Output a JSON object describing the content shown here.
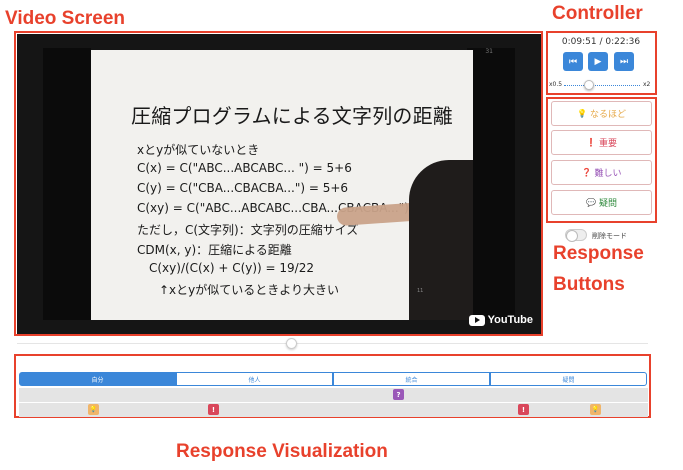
{
  "annotations": {
    "video_screen": "Video Screen",
    "controller": "Controller",
    "response_line1": "Response",
    "response_line2": "Buttons",
    "visualization": "Response Visualization"
  },
  "video": {
    "slide_title": "圧縮プログラムによる文字列の距離",
    "slide_lines": [
      "xとyが似ていないとき",
      "C(x) = C(\"ABC...ABCABC... \") = 5+6",
      "C(y) = C(\"CBA...CBACBA...\") = 5+6",
      "C(xy) = C(\"ABC...ABCABC...CBA...CBACBA...\")",
      "ただし，C(文字列)：文字列の圧縮サイズ",
      "CDM(x, y)：圧縮による距離",
      "C(xy)/(C(x) + C(y)) = 19/22",
      "↑xとyが似ているときより大きい"
    ],
    "slide_page": "11",
    "corner_mark": "31",
    "youtube_label": "YouTube"
  },
  "controller": {
    "time": "0:09:51 / 0:22:36",
    "prev_icon": "skip-back-icon",
    "play_icon": "play-icon",
    "next_icon": "skip-forward-icon",
    "rate_min": "x0.5",
    "rate_max": "x2",
    "rate_level": 0.29
  },
  "responses": [
    {
      "icon": "lightbulb-icon",
      "glyph": "💡",
      "label": "なるほど",
      "color": "#e6a847"
    },
    {
      "icon": "exclamation-icon",
      "glyph": "❗",
      "label": "重要",
      "color": "#d9475b"
    },
    {
      "icon": "question-icon",
      "glyph": "❓",
      "label": "難しい",
      "color": "#9a58b8"
    },
    {
      "icon": "speech-bubble-icon",
      "glyph": "💬",
      "label": "疑問",
      "color": "#2f8a3c"
    }
  ],
  "delete_mode": {
    "label": "削除モード",
    "enabled": false
  },
  "seek": {
    "position": 0.436
  },
  "visualization": {
    "tabs": [
      "自分",
      "他人",
      "統合",
      "疑問"
    ],
    "active_tab": "自分",
    "row1_markers": [
      {
        "type": "question",
        "glyph": "?",
        "color": "#9a58b8"
      }
    ],
    "row2_markers": [
      {
        "type": "lightbulb",
        "glyph": "💡",
        "color": "#f0b56a"
      },
      {
        "type": "exclamation",
        "glyph": "!",
        "color": "#d9475b"
      },
      {
        "type": "exclamation",
        "glyph": "!",
        "color": "#d9475b"
      },
      {
        "type": "lightbulb",
        "glyph": "💡",
        "color": "#f0b56a"
      }
    ]
  }
}
